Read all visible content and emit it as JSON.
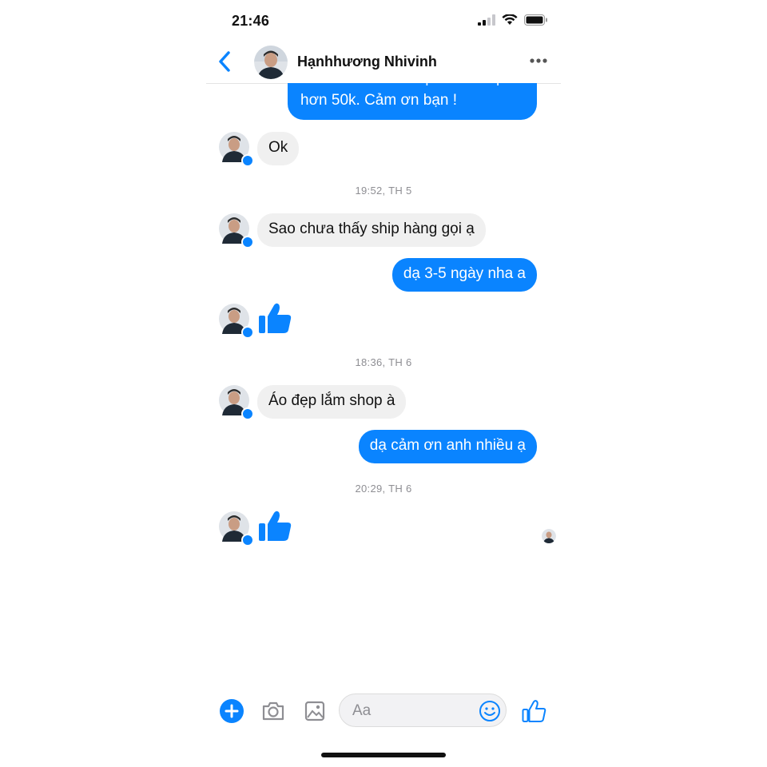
{
  "status_bar": {
    "time": "21:46",
    "icons": [
      "signal-icon",
      "wifi-icon",
      "battery-icon"
    ]
  },
  "header": {
    "contact_name": "Hạnhhương Nhivinh",
    "icons": [
      "back-chevron-icon",
      "avatar",
      "more-dots-icon"
    ]
  },
  "conversation": {
    "partial_outgoing": {
      "line1": "nha. Vì mỗi lần ship đi trả về phí",
      "line2": "hơn 50k. Cảm ơn bạn !"
    },
    "msg_ok": "Ok",
    "ts1": "19:52, TH 5",
    "msg_ask_ship": "Sao chưa thấy ship hàng gọi ạ",
    "msg_reply_days": "dạ 3-5 ngày nha a",
    "like_icon": "thumbs-up-icon",
    "ts2": "18:36, TH 6",
    "msg_nice_shirt": "Áo đẹp lắm shop à",
    "msg_thanks": "dạ cảm ơn anh nhiều ạ",
    "ts3": "20:29, TH 6"
  },
  "composer": {
    "placeholder": "Aa",
    "icons": [
      "plus-icon",
      "camera-icon",
      "image-icon",
      "emoji-icon",
      "thumbs-up-icon"
    ]
  },
  "colors": {
    "accent": "#0a84ff",
    "incoming_bubble": "#f0f0f0",
    "timestamp": "#8e8e93"
  }
}
